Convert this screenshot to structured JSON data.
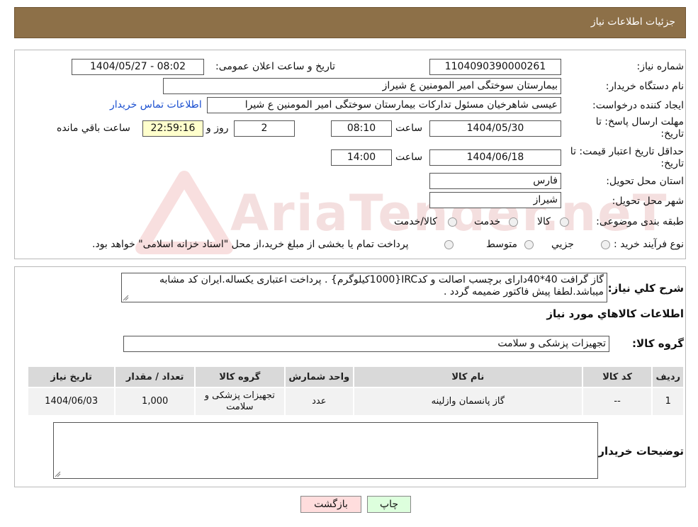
{
  "header": {
    "title": "جزئیات اطلاعات نیاز"
  },
  "info": {
    "need_number_label": "شماره نیاز:",
    "need_number": "1104090390000261",
    "announce_label": "تاریخ و ساعت اعلان عمومی:",
    "announce_value": "1404/05/27 - 08:02",
    "buyer_org_label": "نام دستگاه خریدار:",
    "buyer_org": "بیمارستان سوختگی امیر المومنین  ع  شیراز",
    "requester_label": "ایجاد کننده درخواست:",
    "requester": "عیسی  شاهرخیان مسئول تدارکات بیمارستان سوختگی امیر المومنین  ع  شیرا",
    "contact_link": "اطلاعات تماس خریدار",
    "deadline_label": "مهلت ارسال پاسخ: تا تاریخ:",
    "deadline_date": "1404/05/30",
    "time_label": "ساعت",
    "deadline_time": "08:10",
    "days": "2",
    "days_label": "روز و",
    "remaining_time": "22:59:16",
    "remaining_label": "ساعت باقي مانده",
    "validity_label": "حداقل تاریخ اعتبار قیمت: تا تاریخ:",
    "validity_date": "1404/06/18",
    "validity_time": "14:00",
    "province_label": "استان محل تحویل:",
    "province": "فارس",
    "city_label": "شهر محل تحویل:",
    "city": "شیراز",
    "category_label": "طبقه بندی موضوعی:",
    "category_options": [
      "کالا",
      "خدمت",
      "کالا/خدمت"
    ],
    "process_label": "نوع فرآیند خرید :",
    "process_options": [
      "جزیي",
      "متوسط"
    ],
    "process_note": "پرداخت تمام یا بخشی از مبلغ خرید،از محل \"اسناد خزانه اسلامی\" خواهد بود."
  },
  "description": {
    "label": "شرح کلي نياز:",
    "text": "گاز گرافت 40*40دارای برچسب اصالت و کدIRC{1000کیلوگرم} . پرداخت اعتباری یکساله.ایران کد مشابه میباشد.لطفا پیش فاکتور ضمیمه گردد ."
  },
  "goods": {
    "section_title": "اطلاعات کالاهاي مورد نياز",
    "group_label": "گروه کالا:",
    "group_value": "تجهیزات پزشکی و سلامت",
    "columns": [
      "رديف",
      "کد کالا",
      "نام کالا",
      "واحد شمارش",
      "گروه کالا",
      "تعداد / مقدار",
      "تاریخ نیاز"
    ],
    "rows": [
      {
        "row": "1",
        "code": "--",
        "name": "گاز پانسمان وازلینه",
        "unit": "عدد",
        "group": "تجهیزات پزشکی و سلامت",
        "qty": "1,000",
        "date": "1404/06/03"
      }
    ]
  },
  "buyer_notes": {
    "label": "توضیحات خریدار:",
    "text": ""
  },
  "buttons": {
    "print": "چاپ",
    "back": "بازگشت"
  },
  "watermark": {
    "text": "AriaTender.neT"
  },
  "colors": {
    "header_bg": "#8d7048",
    "link": "#1a4fd0",
    "remaining_bg": "#ffffcc",
    "print_bg": "#ddffdd",
    "back_bg": "#ffdddd"
  }
}
